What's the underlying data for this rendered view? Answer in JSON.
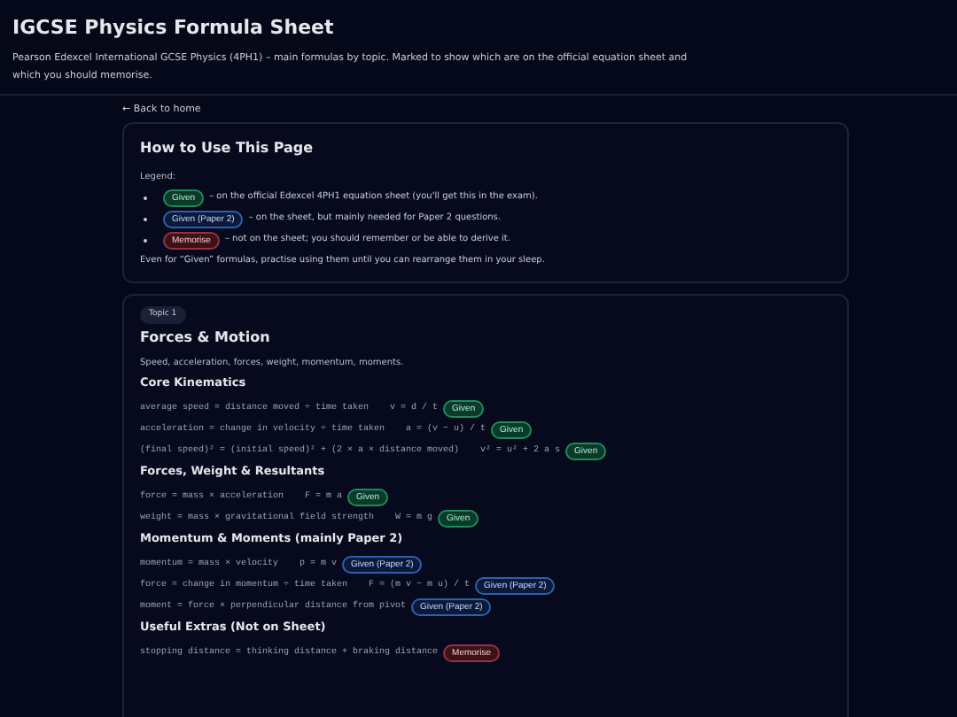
{
  "header": {
    "title": "IGCSE Physics Formula Sheet",
    "description": "Pearson Edexcel International GCSE Physics (4PH1) – main formulas by topic. Marked to show which are on the official equation sheet and which you should memorise."
  },
  "back_link": "← Back to home",
  "intro": {
    "title": "How to Use This Page",
    "legend_label": "Legend:",
    "legend": [
      {
        "kind": "given",
        "badge": "Given",
        "text": "– on the official Edexcel 4PH1 equation sheet (you'll get this in the exam)."
      },
      {
        "kind": "paper2",
        "badge": "Given (Paper 2)",
        "text": "– on the sheet, but mainly needed for Paper 2 questions."
      },
      {
        "kind": "memorise",
        "badge": "Memorise",
        "text": "– not on the sheet; you should remember or be able to derive it."
      }
    ],
    "note": "Even for “Given” formulas, practise using them until you can rearrange them in your sleep."
  },
  "topic": {
    "tag": "Topic 1",
    "title": "Forces & Motion",
    "description": "Speed, acceleration, forces, weight, momentum, moments.",
    "sections": [
      {
        "title": "Core Kinematics",
        "formulas": [
          {
            "words": "average speed = distance moved ÷ time taken",
            "symbols": "v = d / t",
            "kind": "given",
            "badge": "Given"
          },
          {
            "words": "acceleration = change in velocity ÷ time taken",
            "symbols": "a = (v − u) / t",
            "kind": "given",
            "badge": "Given"
          },
          {
            "words": "(final speed)² = (initial speed)² + (2 × a × distance moved)",
            "symbols": "v² = u² + 2 a s",
            "kind": "given",
            "badge": "Given"
          }
        ]
      },
      {
        "title": "Forces, Weight & Resultants",
        "formulas": [
          {
            "words": "force = mass × acceleration",
            "symbols": "F = m a",
            "kind": "given",
            "badge": "Given"
          },
          {
            "words": "weight = mass × gravitational field strength",
            "symbols": "W = m g",
            "kind": "given",
            "badge": "Given"
          }
        ]
      },
      {
        "title": "Momentum & Moments (mainly Paper 2)",
        "formulas": [
          {
            "words": "momentum = mass × velocity",
            "symbols": "p = m v",
            "kind": "paper2",
            "badge": "Given (Paper 2)"
          },
          {
            "words": "force = change in momentum ÷ time taken",
            "symbols": "F = (m v − m u) / t",
            "kind": "paper2",
            "badge": "Given (Paper 2)"
          },
          {
            "words": "moment = force × perpendicular distance from pivot",
            "kind": "paper2",
            "badge": "Given (Paper 2)"
          }
        ]
      },
      {
        "title": "Useful Extras (Not on Sheet)",
        "formulas": [
          {
            "words": "stopping distance = thinking distance + braking distance",
            "kind": "memorise",
            "badge": "Memorise"
          }
        ]
      }
    ]
  }
}
